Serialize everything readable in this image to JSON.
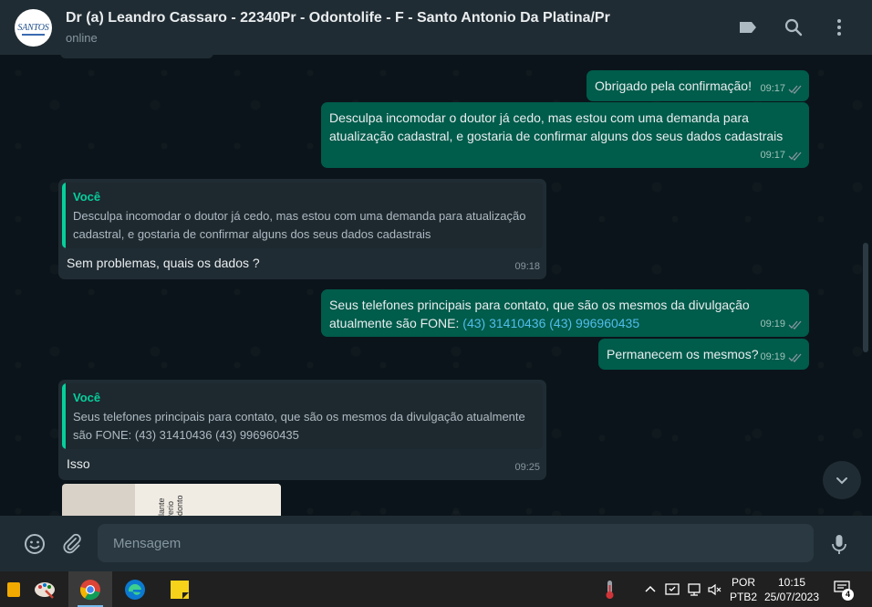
{
  "header": {
    "avatar_text": "SANTOS",
    "title": "Dr (a) Leandro Cassaro - 22340Pr - Odontolife - F - Santo Antonio Da Platina/Pr",
    "status": "online"
  },
  "messages": [
    {
      "text": "Obrigado pela confirmação!",
      "time": "09:17"
    },
    {
      "text": "Desculpa incomodar o doutor já cedo, mas estou com uma demanda para\natualização cadastral, e gostaria de confirmar alguns dos seus dados cadastrais",
      "time": "09:17"
    },
    {
      "quote_name": "Você",
      "quote_text": "Desculpa incomodar o doutor já cedo, mas estou com uma demanda para atualização cadastral, e gostaria de confirmar alguns dos seus dados cadastrais",
      "text": "Sem problemas, quais os dados ?",
      "time": "09:18"
    },
    {
      "text_prefix": "Seus telefones principais para contato, que são os mesmos da divulgação\natualmente são FONE: ",
      "link": "(43) 31410436 (43) 996960435",
      "time": "09:19"
    },
    {
      "text": "Permanecem os mesmos?",
      "time": "09:19"
    },
    {
      "quote_name": "Você",
      "quote_text": "Seus telefones principais para contato, que são os mesmos da divulgação atualmente são FONE: (43) 31410436 (43) 996960435",
      "text": "Isso",
      "time": "09:25"
    }
  ],
  "image_preview": {
    "text": "plante Perio odonto"
  },
  "composer": {
    "placeholder": "Mensagem"
  },
  "taskbar": {
    "lang_top": "POR",
    "lang_bottom": "PTB2",
    "time": "10:15",
    "date": "25/07/2023",
    "notifications": "4"
  },
  "colors": {
    "outgoing": "#005c4b",
    "incoming": "#202c33",
    "accent": "#06cf9c",
    "link": "#53bdeb"
  }
}
